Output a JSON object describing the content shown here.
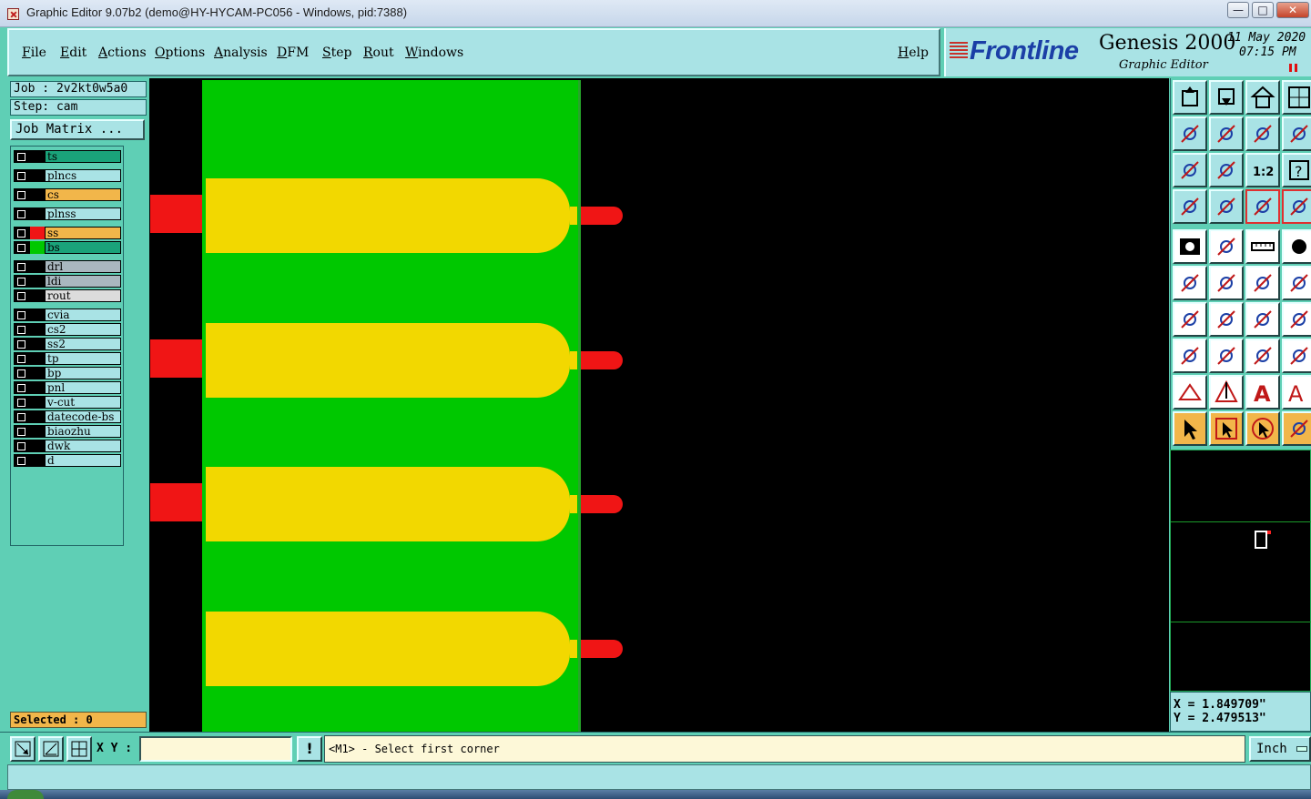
{
  "window": {
    "title": "Graphic Editor 9.07b2 (demo@HY-HYCAM-PC056 - Windows, pid:7388)",
    "controls": [
      "—",
      "□",
      "✕"
    ]
  },
  "menu": {
    "items": [
      "File",
      "Edit",
      "Actions",
      "Options",
      "Analysis",
      "DFM",
      "Step",
      "Rout",
      "Windows"
    ],
    "help": "Help"
  },
  "logo": {
    "brand": "Frontline",
    "product": "Genesis 2000",
    "subtitle": "Graphic Editor",
    "date": "11 May 2020",
    "time": "07:15 PM"
  },
  "left_panel": {
    "job": "Job : 2v2kt0w5a0",
    "step": "Step: cam",
    "job_matrix": "Job Matrix ...",
    "layers": [
      {
        "name": "ts",
        "color": "#1aa37a",
        "swatch": "#000000"
      },
      {
        "name": "plncs",
        "color": "#a9e3e5",
        "swatch": "#000000"
      },
      {
        "name": "cs",
        "color": "#f2b64a",
        "swatch": "#000000"
      },
      {
        "name": "plnss",
        "color": "#a9e3e5",
        "swatch": "#000000"
      },
      {
        "name": "ss",
        "color": "#f2b64a",
        "swatch": "#f01515"
      },
      {
        "name": "bs",
        "color": "#1aa37a",
        "swatch": "#00c800"
      },
      {
        "name": "drl",
        "color": "#a9b7bf",
        "swatch": "#000000"
      },
      {
        "name": "ldi",
        "color": "#a9b7bf",
        "swatch": "#000000"
      },
      {
        "name": "rout",
        "color": "#dcdcdc",
        "swatch": "#000000"
      },
      {
        "name": "cvia",
        "color": "#a9e3e5",
        "swatch": "#000000"
      },
      {
        "name": "cs2",
        "color": "#a9e3e5",
        "swatch": "#000000"
      },
      {
        "name": "ss2",
        "color": "#a9e3e5",
        "swatch": "#000000"
      },
      {
        "name": "tp",
        "color": "#a9e3e5",
        "swatch": "#000000"
      },
      {
        "name": "bp",
        "color": "#a9e3e5",
        "swatch": "#000000"
      },
      {
        "name": "pnl",
        "color": "#a9e3e5",
        "swatch": "#000000"
      },
      {
        "name": "v-cut",
        "color": "#a9e3e5",
        "swatch": "#000000"
      },
      {
        "name": "datecode-bs",
        "color": "#a9e3e5",
        "swatch": "#000000"
      },
      {
        "name": "biaozhu",
        "color": "#a9e3e5",
        "swatch": "#000000"
      },
      {
        "name": "dwk",
        "color": "#a9e3e5",
        "swatch": "#000000"
      },
      {
        "name": "d",
        "color": "#a9e3e5",
        "swatch": "#000000"
      }
    ],
    "selected": "Selected : 0"
  },
  "toolbar_icons": [
    "open-job-icon",
    "save-job-icon",
    "home-icon",
    "layout-icon",
    "step-in-icon",
    "step-out-icon",
    "undo-icon",
    "redo-icon",
    "zoom-fit-icon",
    "zoom-center-icon",
    "zoom-1to2-icon",
    "help-icon",
    "snap-settings-icon",
    "grid-icon",
    "connect-icon",
    "disconnect-icon",
    "pad-icon",
    "polygon-icon",
    "measure-icon",
    "round-pad-icon",
    "node-icon",
    "delete-point-icon",
    "line-point-icon",
    "line-point2-icon",
    "angle-icon",
    "diagonal-icon",
    "arc-icon",
    "split-icon",
    "move-icon",
    "line-icon",
    "resize-icon",
    "copy-icon",
    "triangle-icon",
    "arrow-up-icon",
    "letter-a-icon",
    "letter-a2-icon",
    "select-icon",
    "select-box-icon",
    "select-circle-icon",
    "select-route-icon"
  ],
  "coords": {
    "x": "X = 1.849709\"",
    "y": "Y = 2.479513\""
  },
  "bottom": {
    "xy_label": "X Y :",
    "xy_value": "",
    "message_button": "!",
    "message": "<M1> - Select first corner",
    "units": "Inch"
  }
}
